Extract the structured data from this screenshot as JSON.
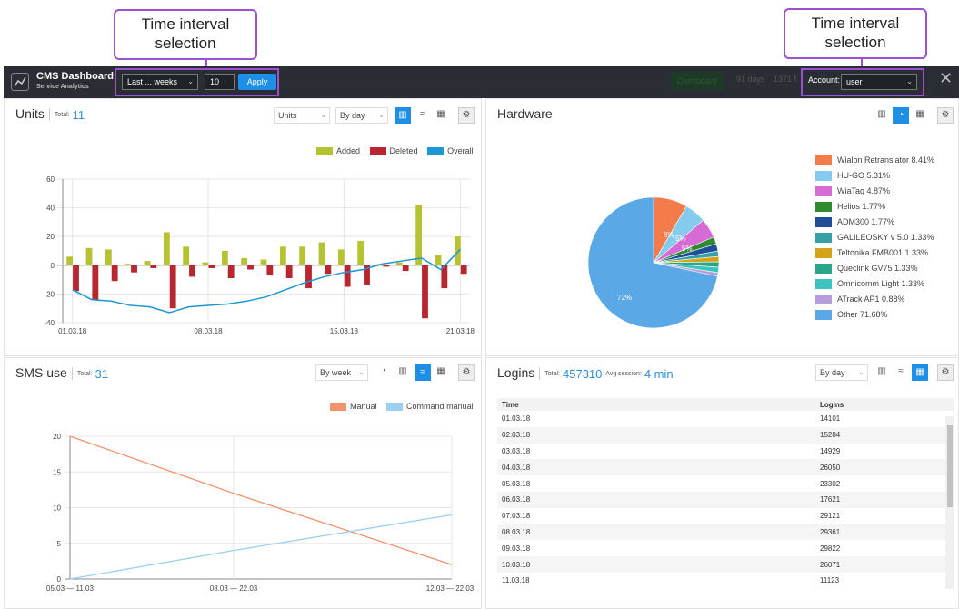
{
  "annotations": {
    "left": "Time interval\nselection",
    "right": "Time interval\nselection"
  },
  "topbar": {
    "app_title": "CMS Dashboard",
    "app_subtitle": "Service Analytics",
    "period_select": "Last ... weeks",
    "period_count": "10",
    "apply_label": "Apply",
    "dashboard_btn": "Dashboard",
    "info_days": "91 days",
    "info_extra": "1371 f",
    "account_label": "Account:",
    "account_value": "user"
  },
  "units": {
    "title": "Units",
    "total_label": "Total:",
    "total_value": "11",
    "select_metric": "Units",
    "select_period": "By day",
    "legend": [
      {
        "name": "Added",
        "color": "#b5c232"
      },
      {
        "name": "Deleted",
        "color": "#b8272f"
      },
      {
        "name": "Overall",
        "color": "#1c97d1"
      }
    ],
    "yticks": [
      "60",
      "40",
      "20",
      "0",
      "-20",
      "-40"
    ],
    "xticks": [
      "01.03.18",
      "08.03.18",
      "15.03.18",
      "21.03.18"
    ]
  },
  "chart_data": [
    {
      "type": "bar",
      "title": "Units",
      "ylim": [
        -40,
        60
      ],
      "categories": [
        "01.03",
        "02.03",
        "03.03",
        "04.03",
        "05.03",
        "06.03",
        "07.03",
        "08.03",
        "09.03",
        "10.03",
        "11.03",
        "12.03",
        "13.03",
        "14.03",
        "15.03",
        "16.03",
        "17.03",
        "18.03",
        "19.03",
        "20.03",
        "21.03"
      ],
      "series": [
        {
          "name": "Added",
          "values": [
            6,
            12,
            11,
            1,
            3,
            23,
            13,
            2,
            10,
            5,
            4,
            13,
            13,
            16,
            11,
            17,
            1,
            2,
            42,
            7,
            20
          ]
        },
        {
          "name": "Deleted",
          "values": [
            -18,
            -24,
            -11,
            -5,
            -2,
            -30,
            -8,
            -2,
            -9,
            -3,
            -7,
            -9,
            -16,
            -6,
            -15,
            -14,
            -1,
            -4,
            -37,
            -16,
            -6
          ]
        },
        {
          "name": "Overall",
          "values": [
            -17,
            -24,
            -25,
            -28,
            -29,
            -33,
            -29,
            -28,
            -27,
            -25,
            -22,
            -17,
            -12,
            -8,
            -5,
            -3,
            1,
            3,
            5,
            -3,
            11
          ]
        }
      ]
    },
    {
      "type": "pie",
      "title": "Hardware",
      "categories": [
        "Wialon Retranslator",
        "HU-GO",
        "WiaTag",
        "Helios",
        "ADM300",
        "GALILEOSKY v 5.0",
        "Teltonika FMB001",
        "Queclink GV75",
        "Omnicomm Light",
        "ATrack AP1",
        "Other"
      ],
      "values": [
        8.41,
        5.31,
        4.87,
        1.77,
        1.77,
        1.33,
        1.33,
        1.33,
        1.33,
        0.88,
        71.68
      ],
      "colors": [
        "#f47c4a",
        "#85cbee",
        "#d66bd6",
        "#2e8b2e",
        "#1f4e99",
        "#35a0a8",
        "#d4a317",
        "#2aa58a",
        "#3cc4c0",
        "#b59ddb",
        "#5aa9e6"
      ]
    },
    {
      "type": "line",
      "title": "SMS use",
      "categories": [
        "05.03 — 11.03",
        "08.03 — 22.03",
        "12.03 — 22.03"
      ],
      "ylim": [
        0,
        20
      ],
      "series": [
        {
          "name": "Manual",
          "values": [
            20,
            12,
            2
          ]
        },
        {
          "name": "Command manual",
          "values": [
            0,
            4,
            9
          ]
        }
      ]
    }
  ],
  "hardware": {
    "title": "Hardware",
    "slice_labels": [
      "8%",
      "5%",
      "5%",
      "72%"
    ],
    "legend": [
      "Wialon Retranslator 8.41%",
      "HU-GO 5.31%",
      "WiaTag 4.87%",
      "Helios 1.77%",
      "ADM300 1.77%",
      "GALILEOSKY v 5.0 1.33%",
      "Teltonika FMB001 1.33%",
      "Queclink GV75 1.33%",
      "Omnicomm Light 1.33%",
      "ATrack AP1 0.88%",
      "Other 71.68%"
    ]
  },
  "sms": {
    "title": "SMS use",
    "total_label": "Total:",
    "total_value": "31",
    "select_period": "By week",
    "legend": [
      {
        "name": "Manual",
        "color": "#f4926c"
      },
      {
        "name": "Command manual",
        "color": "#9bd0f2"
      }
    ],
    "yticks": [
      "20",
      "15",
      "10",
      "5",
      "0"
    ],
    "xticks": [
      "05.03 — 11.03",
      "08.03 — 22.03",
      "12.03 — 22.03"
    ]
  },
  "logins": {
    "title": "Logins",
    "total_label": "Total:",
    "total_value": "457310",
    "avg_label": "Avg session:",
    "avg_value": "4 min",
    "select_period": "By day",
    "columns": [
      "Time",
      "Logins"
    ],
    "rows": [
      [
        "01.03.18",
        "14101"
      ],
      [
        "02.03.18",
        "15284"
      ],
      [
        "03.03.18",
        "14929"
      ],
      [
        "04.03.18",
        "26050"
      ],
      [
        "05.03.18",
        "23302"
      ],
      [
        "06.03.18",
        "17621"
      ],
      [
        "07.03.18",
        "29121"
      ],
      [
        "08.03.18",
        "29361"
      ],
      [
        "09.03.18",
        "29822"
      ],
      [
        "10.03.18",
        "26071"
      ],
      [
        "11.03.18",
        "11123"
      ]
    ]
  }
}
